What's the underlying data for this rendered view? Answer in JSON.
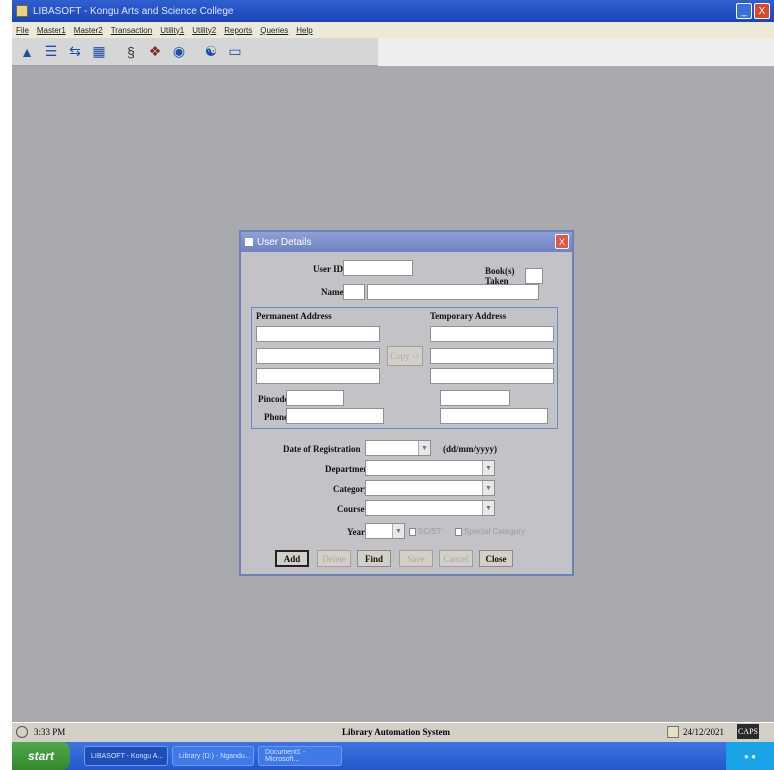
{
  "window": {
    "title": "LIBASOFT - Kongu Arts and Science College",
    "min_label": "_",
    "close_label": "X"
  },
  "menu": [
    "File",
    "Master1",
    "Master2",
    "Transaction",
    "Utility1",
    "Utility2",
    "Reports",
    "Queries",
    "Help"
  ],
  "toolbar_icons": [
    "users-icon",
    "books-icon",
    "transfer-icon",
    "printer-icon",
    "issue-icon",
    "search-icon",
    "globe-icon",
    "help-icon",
    "exit-icon"
  ],
  "dialog": {
    "title": "User Details",
    "close_label": "X",
    "user_id_label": "User ID",
    "name_label": "Name",
    "books_taken_label_1": "Book(s)",
    "books_taken_label_2": "Taken",
    "permanent_address_label": "Permanent Address",
    "temporary_address_label": "Temporary Address",
    "copy_button": "Copy ->",
    "pincode_label": "Pincode",
    "phone_label": "Phone",
    "date_of_registration_label": "Date of Registration",
    "date_format_label": "(dd/mm/yyyy)",
    "department_label": "Department",
    "category_label": "Category",
    "course_label": "Course",
    "year_label": "Year",
    "scst_label": "SC/ST",
    "special_category_label": "Special Category",
    "buttons": {
      "add": "Add",
      "delete": "Delete",
      "find": "Find",
      "save": "Save",
      "cancel": "Cancel",
      "close": "Close"
    }
  },
  "statusbar": {
    "time": "3:33 PM",
    "center": "Library Automation System",
    "date": "24/12/2021",
    "tag": "CAPS"
  },
  "taskbar": {
    "start": "start",
    "tasks": [
      "LIBASOFT - Kongu A...",
      "Library (D:) - Ngandu...",
      "Document1 - Microsoft..."
    ]
  }
}
